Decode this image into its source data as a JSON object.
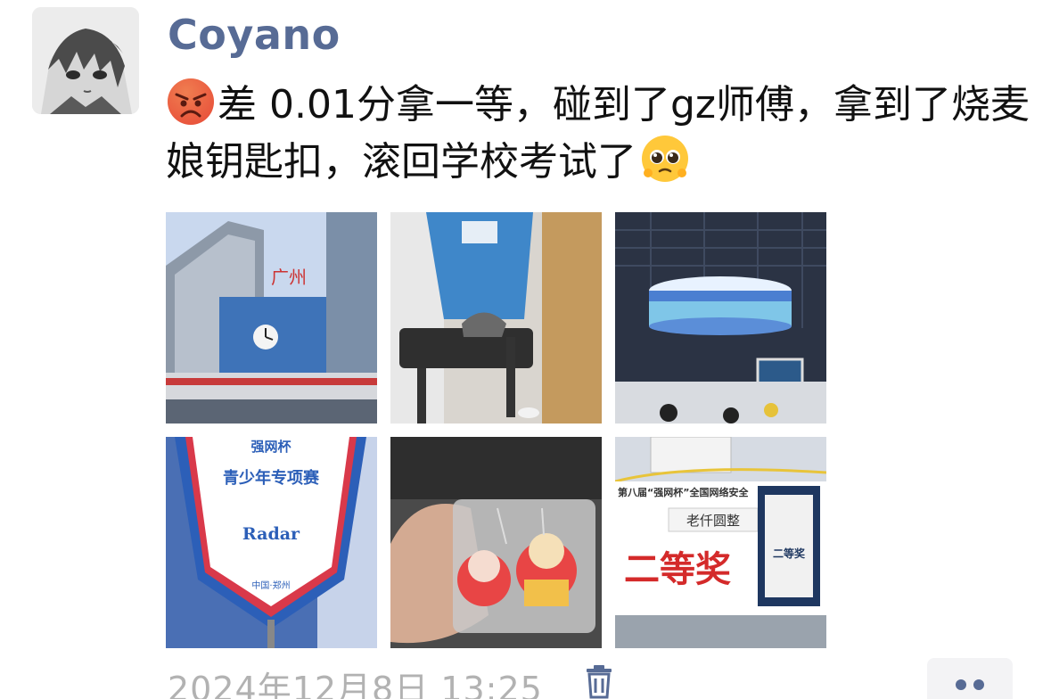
{
  "post": {
    "username": "Coyano",
    "text_part1": "差 0.01分拿一等，碰到了gz师傅，拿到了烧麦娘钥匙扣，滚回学校考试了",
    "leading_emoji": "angry-face-icon",
    "trailing_emoji": "pleading-face-icon",
    "timestamp": "2024年12月8日 13:25"
  },
  "photos": [
    {
      "name": "photo-building",
      "caption": "广州",
      "alt": "building exterior with clock"
    },
    {
      "name": "photo-volunteer-ironing",
      "alt": "volunteer ironing"
    },
    {
      "name": "photo-arena-screen",
      "alt": "arena LED ring screen"
    },
    {
      "name": "photo-pennant",
      "logo": "强网杯",
      "title": "青少年专项赛",
      "team": "Radar",
      "footer": "中国·郑州"
    },
    {
      "name": "photo-keychains",
      "alt": "anime keychains in bag"
    },
    {
      "name": "photo-certificate",
      "header": "第八届“强网杯”全国网络安全",
      "name_text": "老仟圆整",
      "award": "二等奖",
      "side": "二等奖"
    }
  ],
  "colors": {
    "username": "#576b95",
    "text": "#111111",
    "timestamp": "#b2b2b2",
    "accent": "#576b95",
    "more_bg": "#f3f3f5"
  },
  "icons": {
    "delete": "trash-icon",
    "more": "more-icon"
  }
}
